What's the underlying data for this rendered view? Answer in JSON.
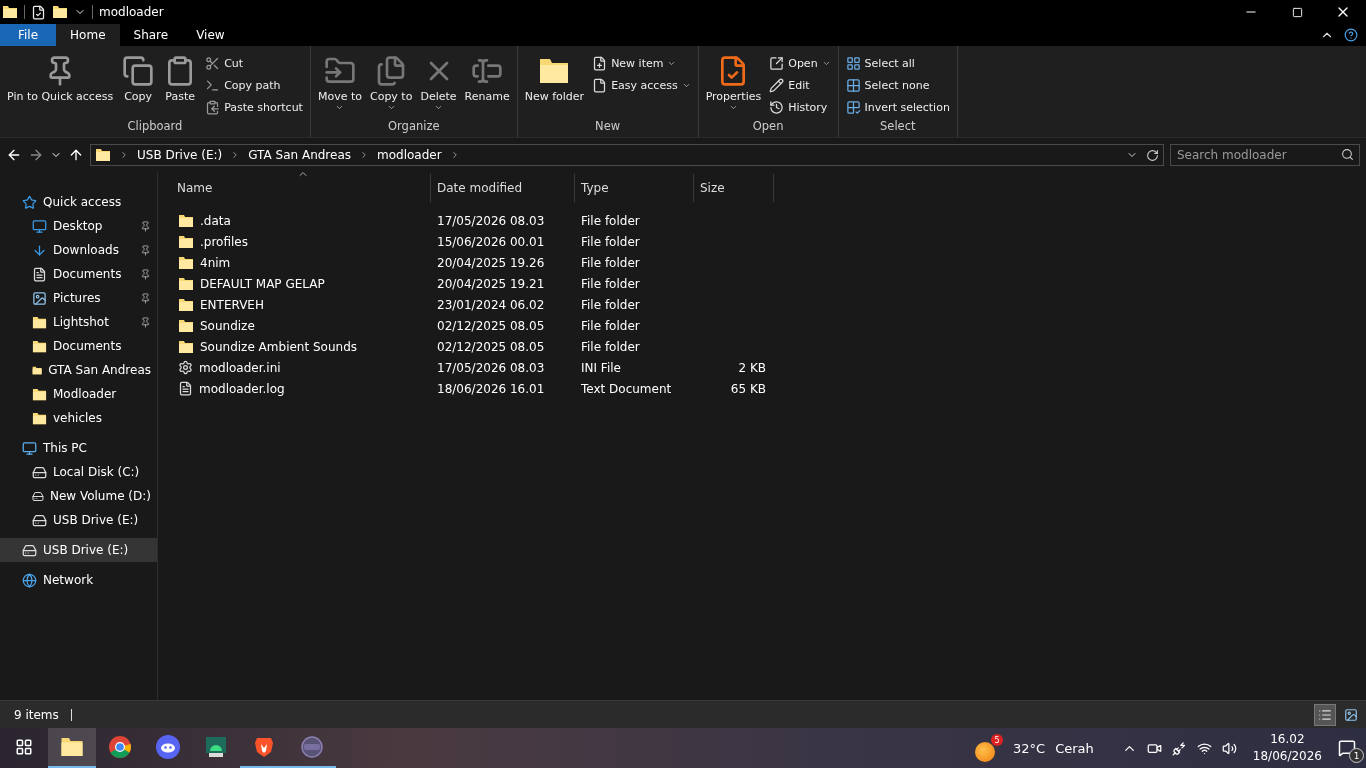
{
  "window": {
    "title": "modloader"
  },
  "ribbon_tabs": [
    {
      "label": "File",
      "kind": "file",
      "selected": false
    },
    {
      "label": "Home",
      "kind": "tab",
      "selected": true
    },
    {
      "label": "Share",
      "kind": "tab",
      "selected": false
    },
    {
      "label": "View",
      "kind": "tab",
      "selected": false
    }
  ],
  "ribbon_groups": [
    {
      "name": "Clipboard",
      "items": [
        {
          "label": "Pin to Quick access",
          "kind": "large",
          "menu": false
        },
        {
          "label": "Copy",
          "kind": "large",
          "menu": false
        },
        {
          "label": "Paste",
          "kind": "large",
          "menu": false
        },
        {
          "label": "Cut",
          "kind": "small",
          "menu": false
        },
        {
          "label": "Copy path",
          "kind": "small",
          "menu": false
        },
        {
          "label": "Paste shortcut",
          "kind": "small",
          "menu": false
        }
      ]
    },
    {
      "name": "Organize",
      "items": [
        {
          "label": "Move to",
          "kind": "large",
          "menu": true
        },
        {
          "label": "Copy to",
          "kind": "large",
          "menu": true
        },
        {
          "label": "Delete",
          "kind": "large",
          "menu": true
        },
        {
          "label": "Rename",
          "kind": "large",
          "menu": false
        }
      ]
    },
    {
      "name": "New",
      "items": [
        {
          "label": "New folder",
          "kind": "large",
          "menu": false
        },
        {
          "label": "New item",
          "kind": "small",
          "menu": true
        },
        {
          "label": "Easy access",
          "kind": "small",
          "menu": true
        }
      ]
    },
    {
      "name": "Open",
      "items": [
        {
          "label": "Properties",
          "kind": "large",
          "menu": true
        },
        {
          "label": "Open",
          "kind": "small",
          "menu": true
        },
        {
          "label": "Edit",
          "kind": "small",
          "menu": false
        },
        {
          "label": "History",
          "kind": "small",
          "menu": false
        }
      ]
    },
    {
      "name": "Select",
      "items": [
        {
          "label": "Select all",
          "kind": "small",
          "menu": false
        },
        {
          "label": "Select none",
          "kind": "small",
          "menu": false
        },
        {
          "label": "Invert selection",
          "kind": "small",
          "menu": false
        }
      ]
    }
  ],
  "address": {
    "path": [
      "USB Drive (E:)",
      "GTA San Andreas",
      "modloader"
    ],
    "search_placeholder": "Search modloader"
  },
  "nav": [
    {
      "label": "Quick access",
      "kind": "star",
      "selected": false,
      "pinned": false,
      "children": [
        {
          "label": "Desktop",
          "kind": "desktop",
          "selected": false,
          "pinned": true
        },
        {
          "label": "Downloads",
          "kind": "download",
          "selected": false,
          "pinned": true
        },
        {
          "label": "Documents",
          "kind": "document",
          "selected": false,
          "pinned": true
        },
        {
          "label": "Pictures",
          "kind": "picture",
          "selected": false,
          "pinned": true
        },
        {
          "label": "Lightshot",
          "kind": "folder",
          "selected": false,
          "pinned": true
        },
        {
          "label": "Documents",
          "kind": "folder",
          "selected": false,
          "pinned": false
        },
        {
          "label": "GTA San Andreas",
          "kind": "folder",
          "selected": false,
          "pinned": false
        },
        {
          "label": "Modloader",
          "kind": "folder",
          "selected": false,
          "pinned": false
        },
        {
          "label": "vehicles",
          "kind": "folder",
          "selected": false,
          "pinned": false
        }
      ]
    },
    {
      "label": "This PC",
      "kind": "pc",
      "selected": false,
      "pinned": false,
      "children": [
        {
          "label": "Local Disk (C:)",
          "kind": "system-disk",
          "selected": false,
          "pinned": false
        },
        {
          "label": "New Volume (D:)",
          "kind": "disk",
          "selected": false,
          "pinned": false
        },
        {
          "label": "USB Drive (E:)",
          "kind": "disk",
          "selected": false,
          "pinned": false
        }
      ]
    },
    {
      "label": "USB Drive (E:)",
      "kind": "disk",
      "selected": true,
      "pinned": false
    },
    {
      "label": "Network",
      "kind": "network",
      "selected": false,
      "pinned": false
    }
  ],
  "columns": [
    {
      "label": "Name",
      "sorted": true
    },
    {
      "label": "Date modified",
      "sorted": false
    },
    {
      "label": "Type",
      "sorted": false
    },
    {
      "label": "Size",
      "sorted": false
    }
  ],
  "files": [
    {
      "name": ".data",
      "date": "17/05/2026 08.03",
      "type": "File folder",
      "kind": "folder"
    },
    {
      "name": ".profiles",
      "date": "15/06/2026 00.01",
      "type": "File folder",
      "kind": "folder"
    },
    {
      "name": "4nim",
      "date": "20/04/2025 19.26",
      "type": "File folder",
      "kind": "folder"
    },
    {
      "name": "DEFAULT MAP GELAP",
      "date": "20/04/2025 19.21",
      "type": "File folder",
      "kind": "folder"
    },
    {
      "name": "ENTERVEH",
      "date": "23/01/2024 06.02",
      "type": "File folder",
      "kind": "folder"
    },
    {
      "name": "Soundize",
      "date": "02/12/2025 08.05",
      "type": "File folder",
      "kind": "folder"
    },
    {
      "name": "Soundize Ambient Sounds",
      "date": "02/12/2025 08.05",
      "type": "File folder",
      "kind": "folder"
    },
    {
      "name": "modloader.ini",
      "date": "17/05/2026 08.03",
      "type": "INI File",
      "size": "2 KB",
      "kind": "settings"
    },
    {
      "name": "modloader.log",
      "date": "18/06/2026 16.01",
      "type": "Text Document",
      "size": "65 KB",
      "kind": "text"
    }
  ],
  "status_bar": {
    "count": "9 items",
    "views": [
      {
        "kind": "details",
        "selected": true
      },
      {
        "kind": "large-icons",
        "selected": false
      }
    ]
  },
  "taskbar": {
    "apps": [
      {
        "kind": "explorer",
        "active": true,
        "running": true
      },
      {
        "kind": "chrome",
        "active": false,
        "running": false
      },
      {
        "kind": "discord",
        "active": false,
        "running": false
      },
      {
        "kind": "android",
        "active": false,
        "running": false
      },
      {
        "kind": "brave",
        "active": false,
        "running": true
      },
      {
        "kind": "vpn",
        "active": false,
        "running": true
      }
    ],
    "weather": {
      "badge": "5",
      "temperature": "32°C",
      "condition": "Cerah"
    },
    "time": "16.02",
    "date": "18/06/2026",
    "notifications": "1"
  }
}
